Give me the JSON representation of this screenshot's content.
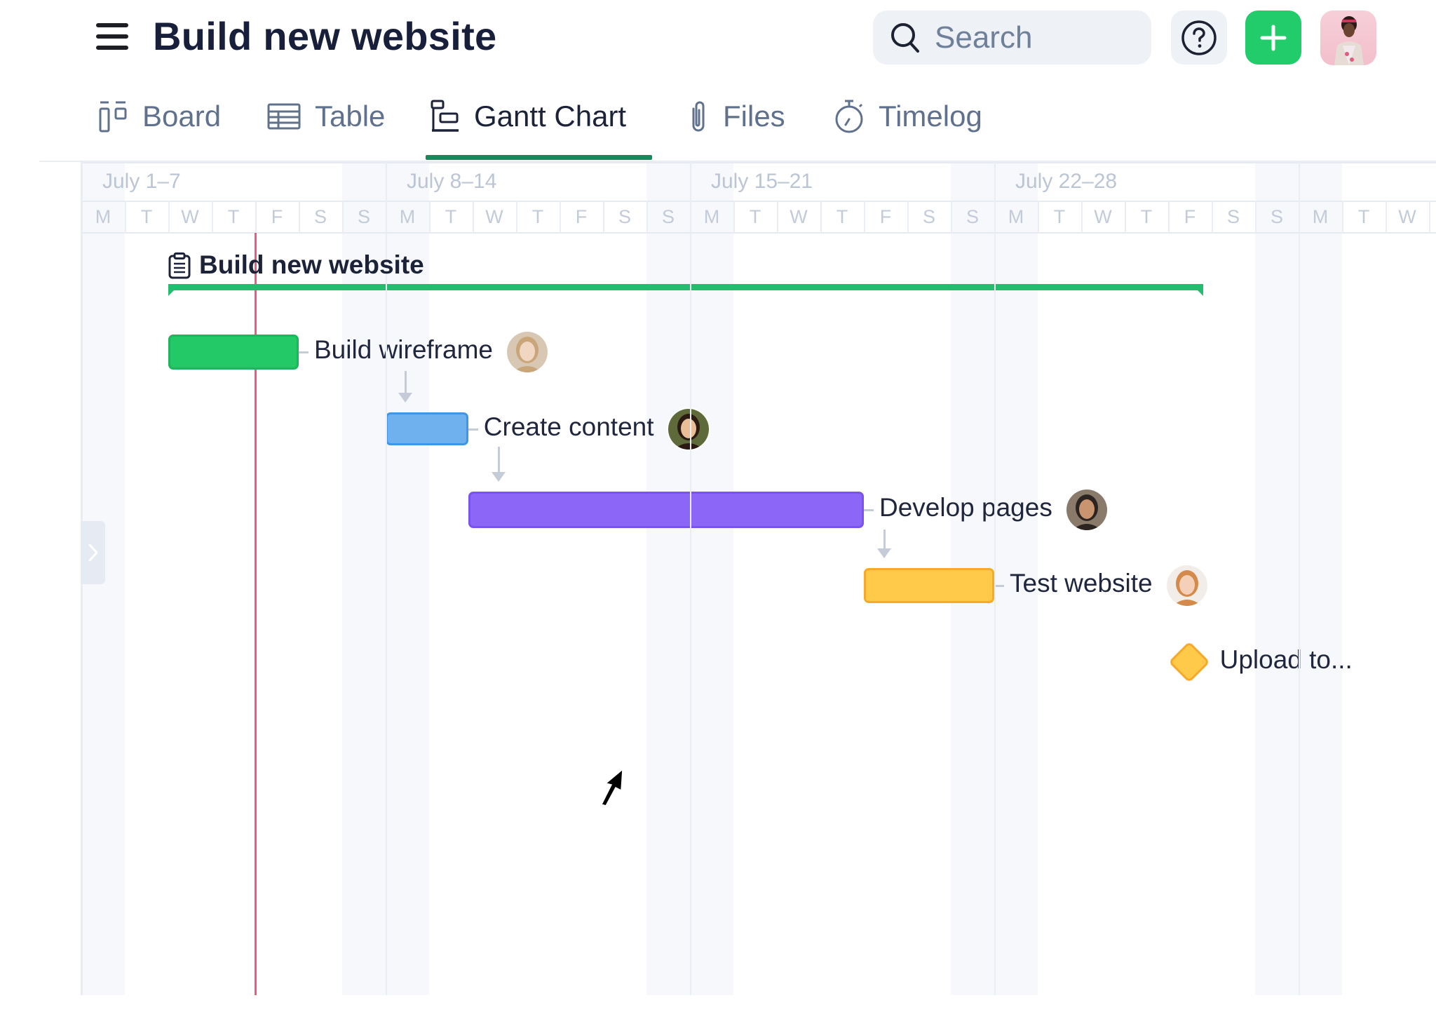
{
  "header": {
    "title": "Build new website",
    "menu_icon": "hamburger-menu-icon",
    "search": {
      "placeholder": "Search",
      "value": "",
      "icon": "search-icon"
    },
    "help_icon": "question-circle-icon",
    "add_icon": "plus-icon",
    "user_avatar": "user-avatar"
  },
  "tabs": [
    {
      "label": "Board",
      "icon": "board-icon",
      "active": false
    },
    {
      "label": "Table",
      "icon": "table-icon",
      "active": false
    },
    {
      "label": "Gantt Chart",
      "icon": "gantt-icon",
      "active": true
    },
    {
      "label": "Files",
      "icon": "paperclip-icon",
      "active": false
    },
    {
      "label": "Timelog",
      "icon": "stopwatch-icon",
      "active": false
    }
  ],
  "timeline": {
    "start_date": "July 1",
    "weeks": [
      "July 1–7",
      "July 8–14",
      "July 15–21",
      "July 22–28",
      ""
    ],
    "day_letters": [
      "M",
      "T",
      "W",
      "T",
      "F",
      "S",
      "S"
    ],
    "today_day": 5,
    "collapse_icon": "chevron-right-icon"
  },
  "colors": {
    "accent": "#23cc6a",
    "tab_underline": "#158a5a",
    "today_line": "#ef5b78",
    "project_bar": "#22bd6f"
  },
  "chart_data": {
    "type": "gantt",
    "title": "Build new website",
    "x_unit": "day of July",
    "project": {
      "name": "Build new website",
      "start": 3,
      "end": 26.8
    },
    "today": 5,
    "tasks": [
      {
        "name": "Build wireframe",
        "start": 3,
        "end": 6,
        "color": "#22c966",
        "border": "#1fb55c",
        "assignee": "woman-blonde"
      },
      {
        "name": "Create content",
        "start": 8,
        "end": 9.9,
        "color": "#6fb0ee",
        "border": "#3f95e6",
        "assignee": "woman-dark-hair"
      },
      {
        "name": "Develop pages",
        "start": 9.9,
        "end": 19,
        "color": "#8b66f7",
        "border": "#7a52f0",
        "assignee": "man-glasses"
      },
      {
        "name": "Test website",
        "start": 19,
        "end": 22,
        "color": "#ffc94a",
        "border": "#f7a92a",
        "assignee": "woman-red-hair"
      }
    ],
    "milestones": [
      {
        "name": "Upload to...",
        "date": 26.3,
        "color": "#ffc94a"
      }
    ],
    "dependencies": [
      [
        "Build wireframe",
        "Create content"
      ],
      [
        "Create content",
        "Develop pages"
      ],
      [
        "Develop pages",
        "Test website"
      ]
    ]
  }
}
